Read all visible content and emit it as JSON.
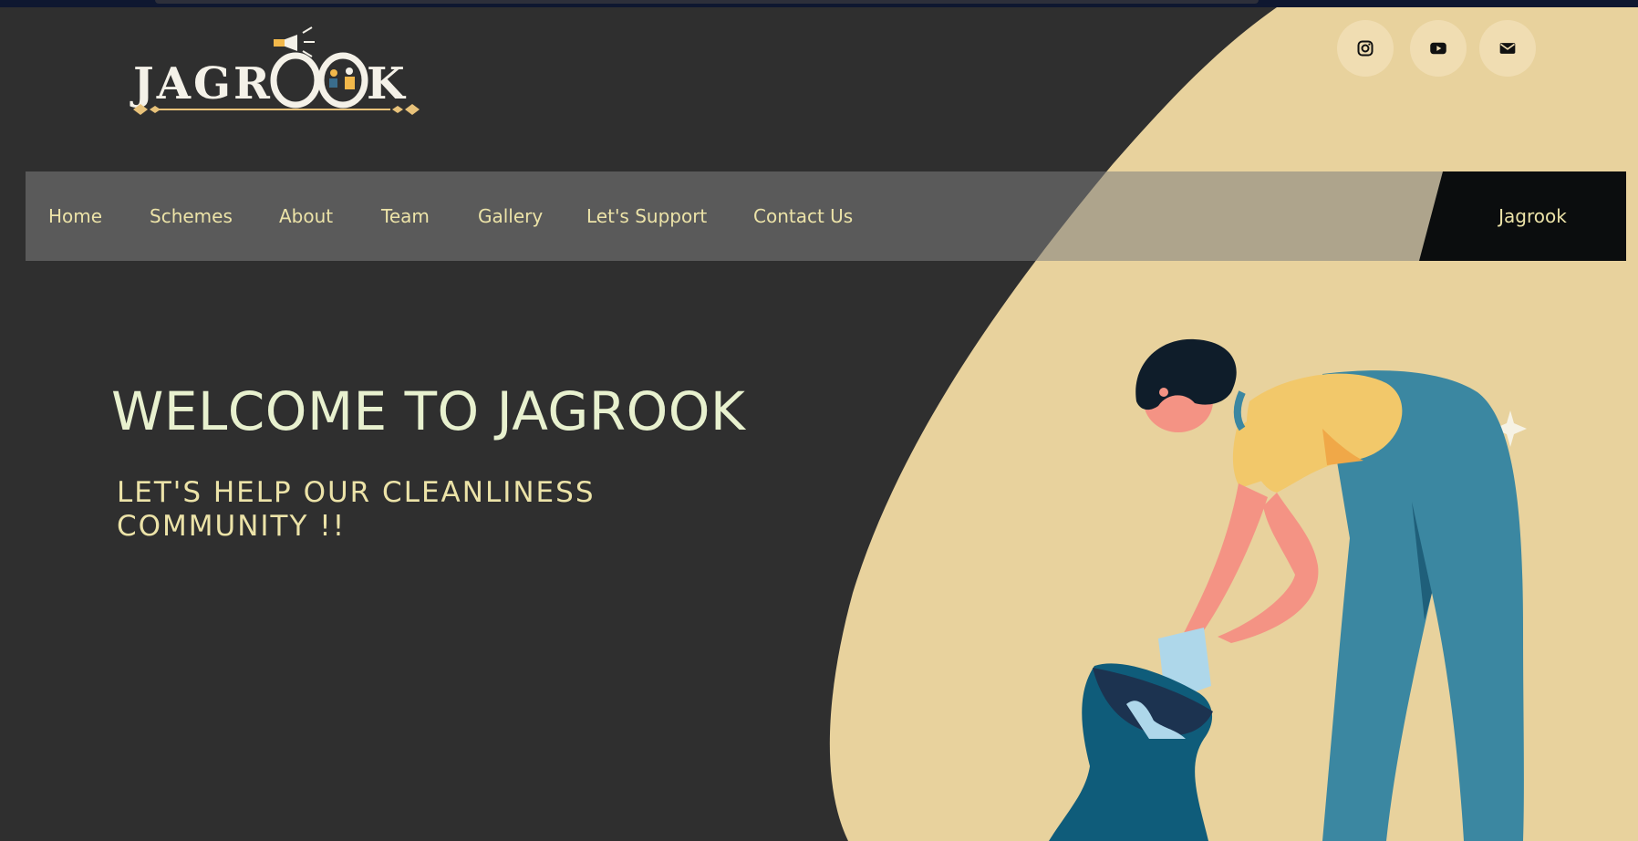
{
  "logo": {
    "text": "JAGROOK"
  },
  "social": [
    {
      "name": "instagram",
      "icon": "instagram-icon"
    },
    {
      "name": "youtube",
      "icon": "youtube-icon"
    },
    {
      "name": "email",
      "icon": "envelope-icon"
    }
  ],
  "nav": {
    "items": [
      "Home",
      "Schemes",
      "About",
      "Team",
      "Gallery",
      "Let's Support",
      "Contact Us"
    ],
    "brand": "Jagrook"
  },
  "hero": {
    "title": "WELCOME TO JAGROOK",
    "tagline_line1": "LET'S HELP OUR CLEANLINESS",
    "tagline_line2": "COMMUNITY !!"
  },
  "colors": {
    "background": "#2f2f2f",
    "accent_shape": "#e8d29d",
    "nav_text": "#ece3a8",
    "title_text": "#e8f1cf"
  }
}
